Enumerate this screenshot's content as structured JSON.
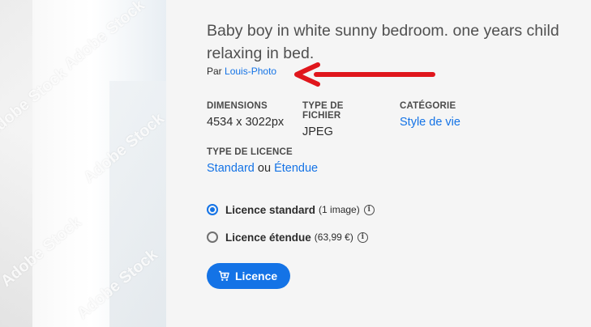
{
  "preview": {
    "watermark": "Adobe Stock"
  },
  "asset": {
    "title": "Baby boy in white sunny bedroom. one years child relaxing in bed.",
    "by_prefix": "Par",
    "author": "Louis-Photo"
  },
  "meta": {
    "dimensions_label": "DIMENSIONS",
    "dimensions_value": "4534 x 3022px",
    "filetype_label": "TYPE DE FICHIER",
    "filetype_value": "JPEG",
    "category_label": "CATÉGORIE",
    "category_value": "Style de vie"
  },
  "licence_type": {
    "label": "TYPE DE LICENCE",
    "standard": "Standard",
    "separator": "ou",
    "extended": "Étendue"
  },
  "options": [
    {
      "label": "Licence standard",
      "detail": "(1 image)",
      "selected": true
    },
    {
      "label": "Licence étendue",
      "detail": "(63,99 €)",
      "selected": false
    }
  ],
  "button": {
    "label": "Licence",
    "icon": "cart-icon"
  },
  "colors": {
    "accent": "#1473e6",
    "arrow": "#e0161c"
  }
}
